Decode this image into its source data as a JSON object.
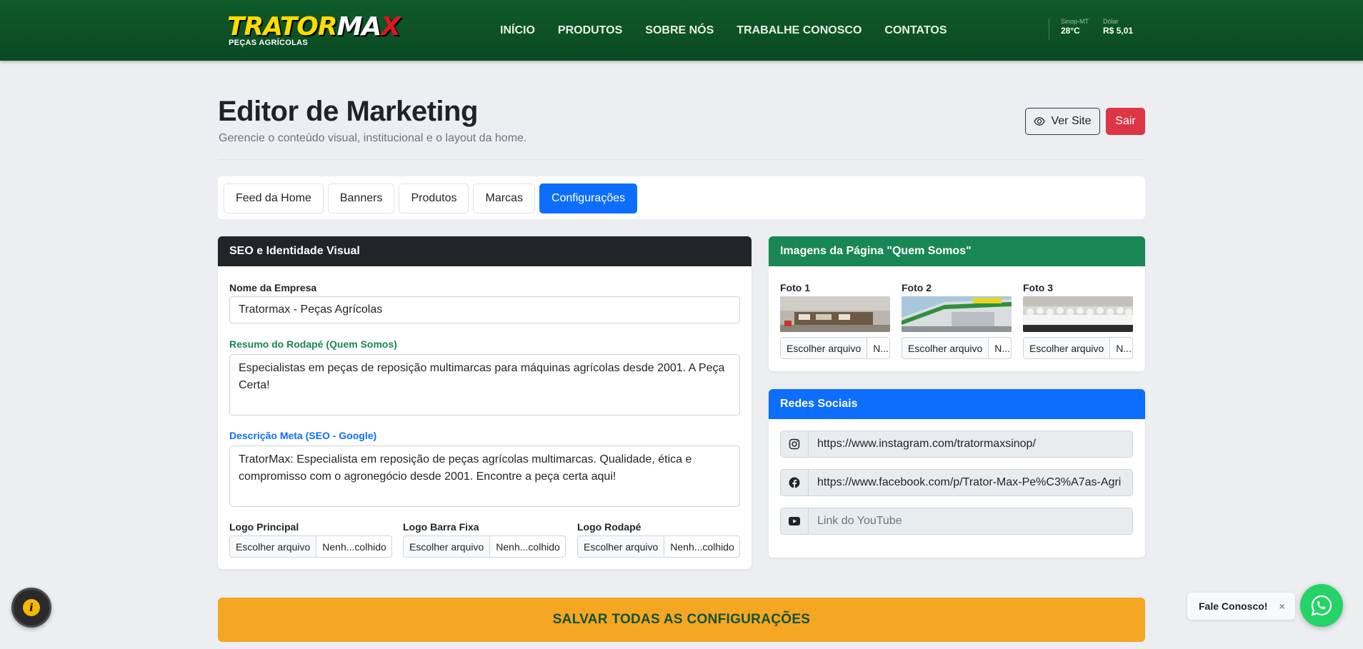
{
  "header": {
    "logo": {
      "trator": "TRATOR",
      "max": "MA",
      "x": "X",
      "sub": "PEÇAS AGRÍCOLAS"
    },
    "nav": [
      "INÍCIO",
      "PRODUTOS",
      "SOBRE NÓS",
      "TRABALHE CONOSCO",
      "CONTATOS"
    ],
    "weather": {
      "location": "Sinop-MT",
      "temp": "28°C"
    },
    "dollar": {
      "label": "Dólar",
      "value": "R$ 5,01"
    }
  },
  "page": {
    "title": "Editor de Marketing",
    "subtitle": "Gerencie o conteúdo visual, institucional e o layout da home.",
    "ver_site": "Ver Site",
    "sair": "Sair"
  },
  "tabs": [
    {
      "label": "Feed da Home",
      "active": false
    },
    {
      "label": "Banners",
      "active": false
    },
    {
      "label": "Produtos",
      "active": false
    },
    {
      "label": "Marcas",
      "active": false
    },
    {
      "label": "Configurações",
      "active": true
    }
  ],
  "seo": {
    "title": "SEO e Identidade Visual",
    "company_label": "Nome da Empresa",
    "company_value": "Tratormax - Peças Agrícolas",
    "footer_label": "Resumo do Rodapé (Quem Somos)",
    "footer_value": "Especialistas em peças de reposição multimarcas para máquinas agrícolas desde 2001. A Peça Certa!",
    "meta_label": "Descrição Meta (SEO - Google)",
    "meta_value": "TratorMax: Especialista em reposição de peças agrícolas multimarcas. Qualidade, ética e compromisso com o agronegócio desde 2001. Encontre a peça certa aqui!",
    "logos": [
      {
        "label": "Logo Principal",
        "btn": "Escolher arquivo",
        "file": "Nenh...colhido"
      },
      {
        "label": "Logo Barra Fixa",
        "btn": "Escolher arquivo",
        "file": "Nenh...colhido"
      },
      {
        "label": "Logo Rodapé",
        "btn": "Escolher arquivo",
        "file": "Nenh...colhido"
      }
    ]
  },
  "quem_somos": {
    "title": "Imagens da Página \"Quem Somos\"",
    "photos": [
      {
        "label": "Foto 1",
        "btn": "Escolher arquivo",
        "file": "N..."
      },
      {
        "label": "Foto 2",
        "btn": "Escolher arquivo",
        "file": "N..."
      },
      {
        "label": "Foto 3",
        "btn": "Escolher arquivo",
        "file": "N..."
      }
    ]
  },
  "social": {
    "title": "Redes Sociais",
    "instagram": "https://www.instagram.com/tratormaxsinop/",
    "facebook": "https://www.facebook.com/p/Trator-Max-Pe%C3%A7as-Agri",
    "youtube_placeholder": "Link do YouTube"
  },
  "save_label": "SALVAR TODAS AS CONFIGURAÇÕES",
  "chat": {
    "label": "Fale Conosco!",
    "close": "×"
  },
  "colors": {
    "header_green": "#0f5a2a",
    "primary": "#0d6efd",
    "danger": "#dc3545",
    "success": "#198754",
    "warning": "#f5a623"
  }
}
